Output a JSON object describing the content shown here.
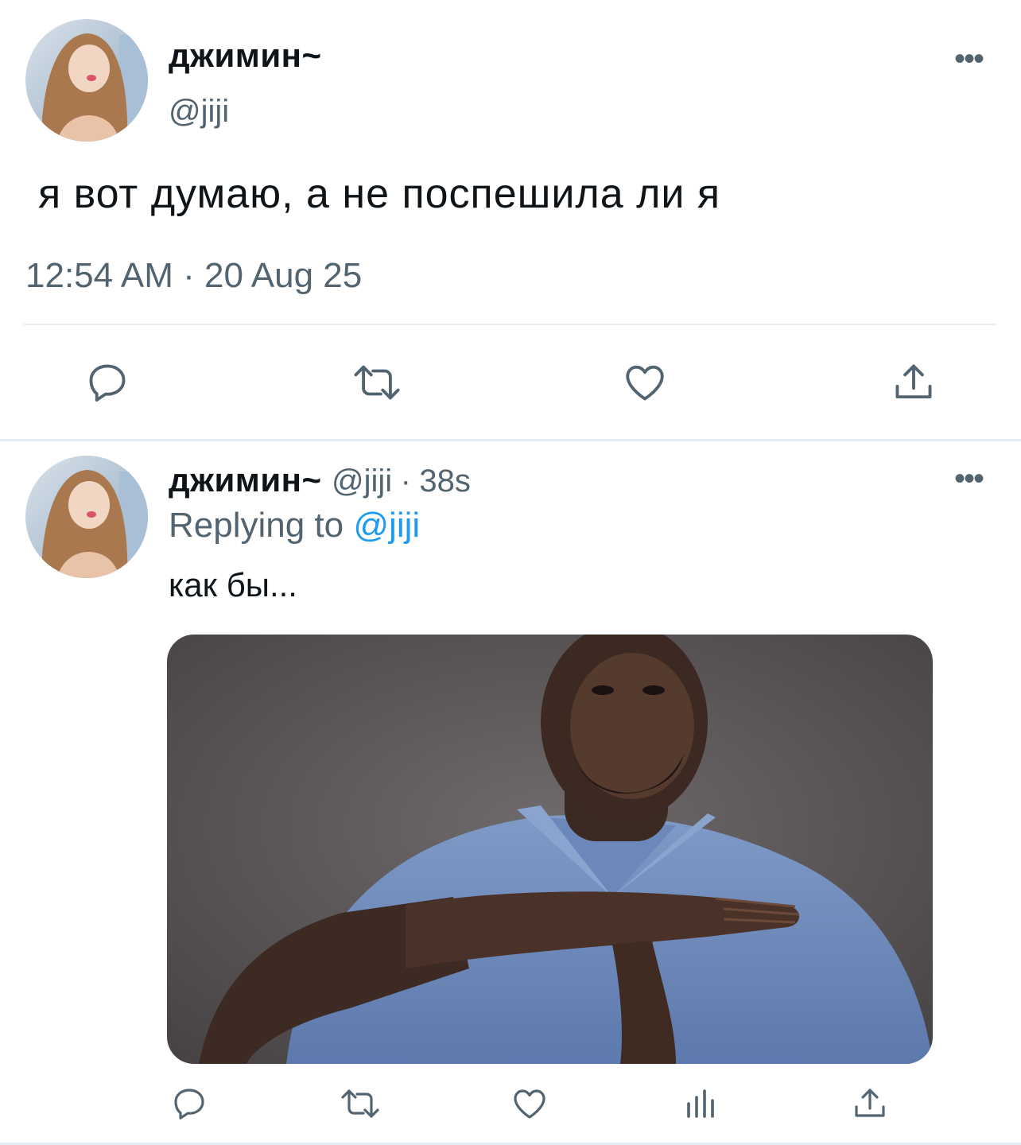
{
  "main_tweet": {
    "display_name": "джимин~",
    "handle": "@jiji",
    "text": "я вот думаю, а не поспешила ли я",
    "timestamp": "12:54 AM · 20 Aug 25",
    "actions": [
      "reply-icon",
      "retweet-icon",
      "like-icon",
      "share-icon"
    ]
  },
  "reply_tweet": {
    "display_name": "джимин~",
    "handle": "@jiji",
    "separator": "·",
    "time": "38s",
    "replying_label": "Replying to",
    "replying_handle": "@jiji",
    "text": "как бы...",
    "actions": [
      "reply-icon",
      "retweet-icon",
      "like-icon",
      "analytics-icon",
      "share-icon"
    ]
  },
  "more_label": "•••",
  "colors": {
    "text": "#0f1419",
    "secondary": "#536471",
    "link": "#1d9bf0",
    "divider": "#e6ecf0"
  }
}
